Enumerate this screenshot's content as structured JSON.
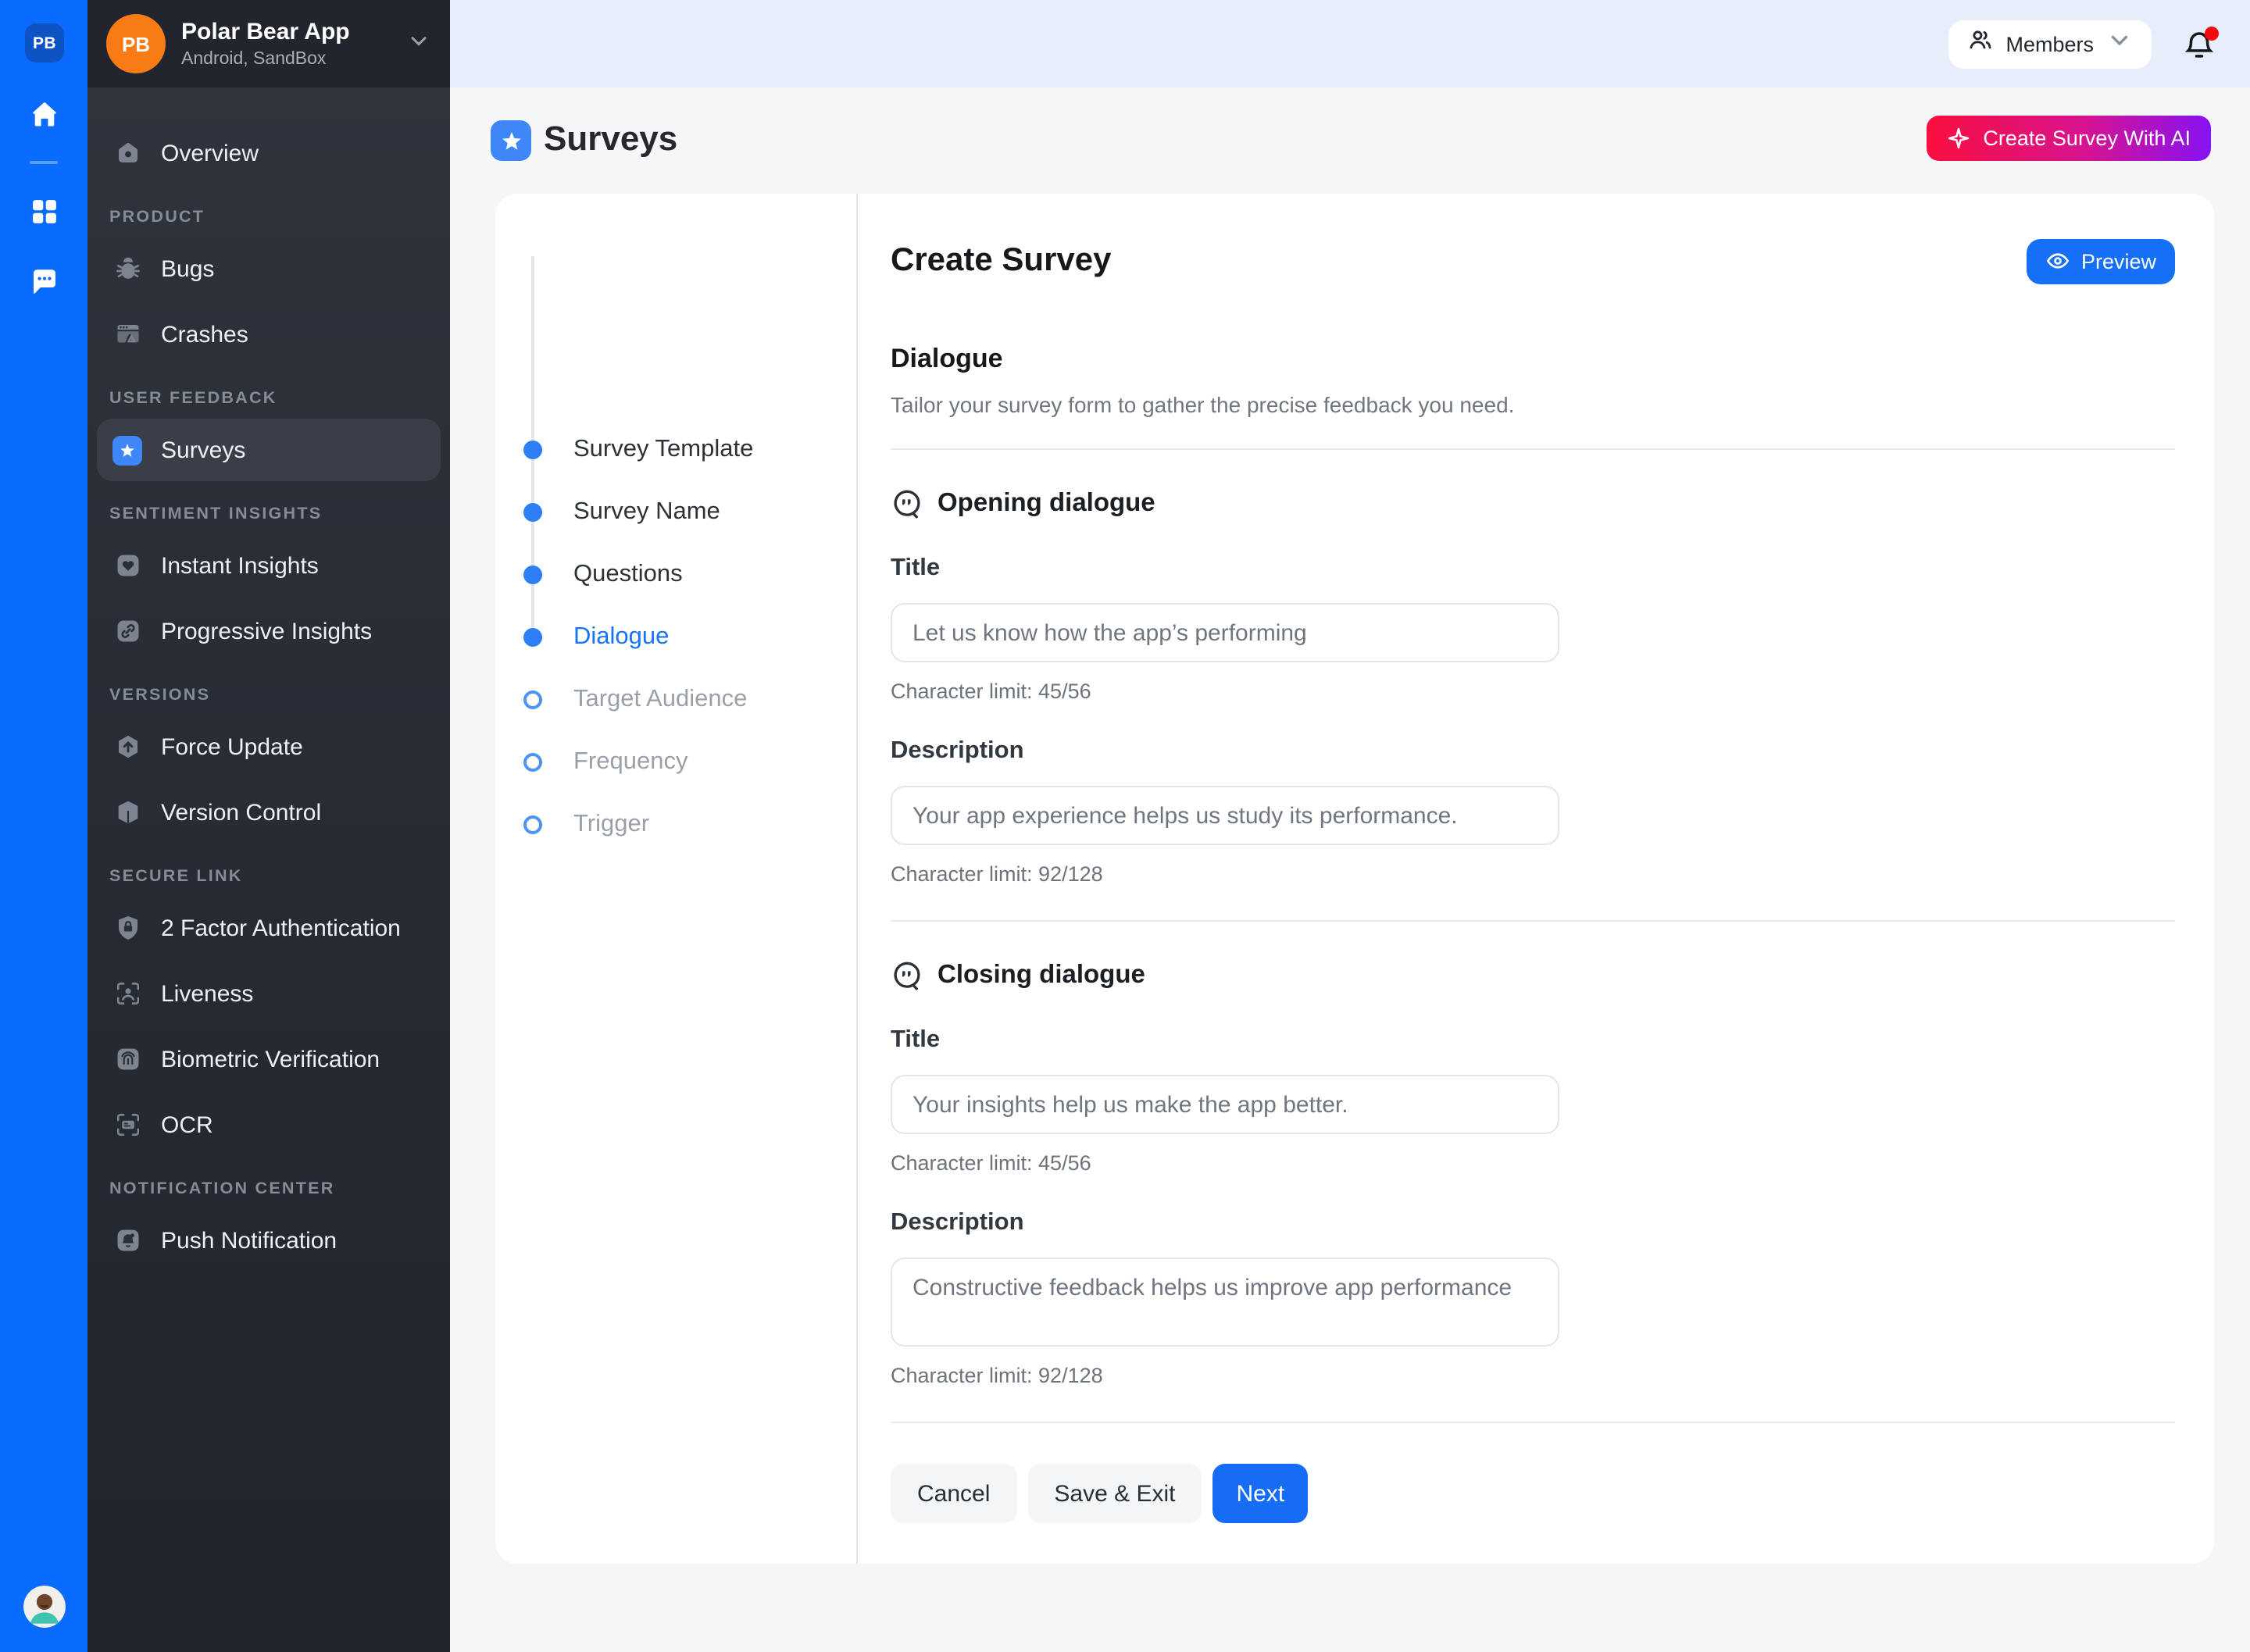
{
  "rail": {
    "logo_text": "PB"
  },
  "workspace": {
    "avatar_text": "PB",
    "name": "Polar Bear App",
    "subtitle": "Android, SandBox"
  },
  "sidebar": {
    "sections": [
      {
        "label": "",
        "items": [
          {
            "label": "Overview"
          }
        ]
      },
      {
        "label": "PRODUCT",
        "items": [
          {
            "label": "Bugs"
          },
          {
            "label": "Crashes"
          }
        ]
      },
      {
        "label": "USER FEEDBACK",
        "items": [
          {
            "label": "Surveys"
          }
        ]
      },
      {
        "label": "SENTIMENT INSIGHTS",
        "items": [
          {
            "label": "Instant Insights"
          },
          {
            "label": "Progressive Insights"
          }
        ]
      },
      {
        "label": "VERSIONS",
        "items": [
          {
            "label": "Force Update"
          },
          {
            "label": "Version Control"
          }
        ]
      },
      {
        "label": "SECURE LINK",
        "items": [
          {
            "label": "2 Factor Authentication"
          },
          {
            "label": "Liveness"
          },
          {
            "label": "Biometric Verification"
          },
          {
            "label": "OCR"
          }
        ]
      },
      {
        "label": "NOTIFICATION CENTER",
        "items": [
          {
            "label": "Push Notification"
          }
        ]
      }
    ]
  },
  "topbar": {
    "members_label": "Members"
  },
  "page": {
    "title": "Surveys",
    "ai_button_label": "Create Survey With AI"
  },
  "stepper": {
    "steps": [
      {
        "label": "Survey Template",
        "state": "done"
      },
      {
        "label": "Survey Name",
        "state": "done"
      },
      {
        "label": "Questions",
        "state": "done"
      },
      {
        "label": "Dialogue",
        "state": "current"
      },
      {
        "label": "Target Audience",
        "state": "todo"
      },
      {
        "label": "Frequency",
        "state": "todo"
      },
      {
        "label": "Trigger",
        "state": "todo"
      }
    ]
  },
  "form": {
    "title": "Create Survey",
    "preview_label": "Preview",
    "section_title": "Dialogue",
    "section_description": "Tailor your survey form to gather the precise feedback you need.",
    "opening": {
      "heading": "Opening dialogue",
      "title_label": "Title",
      "title_placeholder": "Let us know how the app’s performing",
      "title_limit": "Character limit: 45/56",
      "description_label": "Description",
      "description_placeholder": "Your app experience helps us study its performance.",
      "description_limit": "Character limit: 92/128"
    },
    "closing": {
      "heading": "Closing dialogue",
      "title_label": "Title",
      "title_placeholder": "Your insights help us make the app better.",
      "title_limit": "Character limit: 45/56",
      "description_label": "Description",
      "description_placeholder": "Constructive feedback helps us improve app performance",
      "description_limit": "Character limit: 92/128"
    },
    "actions": {
      "cancel": "Cancel",
      "save_exit": "Save & Exit",
      "next": "Next"
    }
  },
  "colors": {
    "rail_blue": "#0a6cff",
    "accent_blue": "#1670f6",
    "star_badge_blue": "#3f87f8",
    "ai_gradient_start": "#fa0f3e",
    "ai_gradient_mid": "#d8138f",
    "ai_gradient_end": "#8712f2",
    "notification_red": "#f40b0b",
    "sidebar_dark": "#282c35",
    "topbar_bg": "#e7edfa",
    "page_bg": "#f5f6f7"
  }
}
